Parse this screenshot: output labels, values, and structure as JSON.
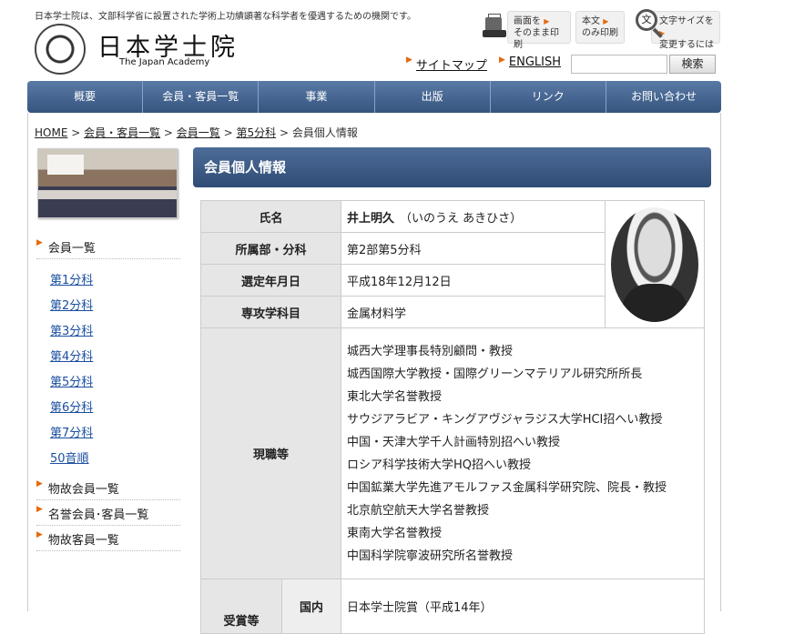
{
  "header": {
    "note": "日本学士院は、文部科学省に設置された学術上功績顕著な科学者を優遇するための機関です。",
    "logo_title": "日本学士院",
    "logo_subtitle": "The Japan Academy",
    "print_full": [
      "画面を",
      "そのまま印刷"
    ],
    "print_text": [
      "本文",
      "のみ印刷"
    ],
    "font_size": [
      "文字サイズを",
      "変更するには"
    ],
    "magnifier_glyph": "文",
    "sitemap": "サイトマップ",
    "english": "ENGLISH",
    "search_value": "",
    "search_button": "検索"
  },
  "nav": [
    "概要",
    "会員・客員一覧",
    "事業",
    "出版",
    "リンク",
    "お問い合わせ"
  ],
  "breadcrumb": {
    "home": "HOME",
    "members_guests": "会員・客員一覧",
    "members": "会員一覧",
    "division": "第5分科",
    "current": "会員個人情報",
    "sep": " > "
  },
  "sidebar": {
    "member_list": "会員一覧",
    "divisions": [
      "第1分科",
      "第2分科",
      "第3分科",
      "第4分科",
      "第5分科",
      "第6分科",
      "第7分科",
      "50音順"
    ],
    "deceased": "物故会員一覧",
    "honorary": "名誉会員･客員一覧",
    "deceased_guests": "物故客員一覧"
  },
  "main": {
    "title": "会員個人情報",
    "rows": {
      "name_label": "氏名",
      "name": "井上明久",
      "name_reading": "（いのうえ あきひさ）",
      "dept_label": "所属部・分科",
      "dept": "第2部第5分科",
      "elected_label": "選定年月日",
      "elected": "平成18年12月12日",
      "field_label": "専攻学科目",
      "field": "金属材料学",
      "duties_label": "現職等",
      "duties": [
        "城西大学理事長特別顧問・教授",
        "城西国際大学教授・国際グリーンマテリアル研究所所長",
        "東北大学名誉教授",
        "サウジアラビア・キングアヴジャラジス大学HCI招へい教授",
        "中国・天津大学千人計画特別招へい教授",
        "ロシア科学技術大学HQ招へい教授",
        "中国鉱業大学先進アモルファス金属科学研究院、院長・教授",
        "北京航空航天大学名誉教授",
        "東南大学名誉教授",
        "中国科学院寧波研究所名誉教授"
      ],
      "awards_label": "受賞等",
      "domestic_label": "国内",
      "award_first": "日本学士院賞（平成14年）"
    }
  }
}
